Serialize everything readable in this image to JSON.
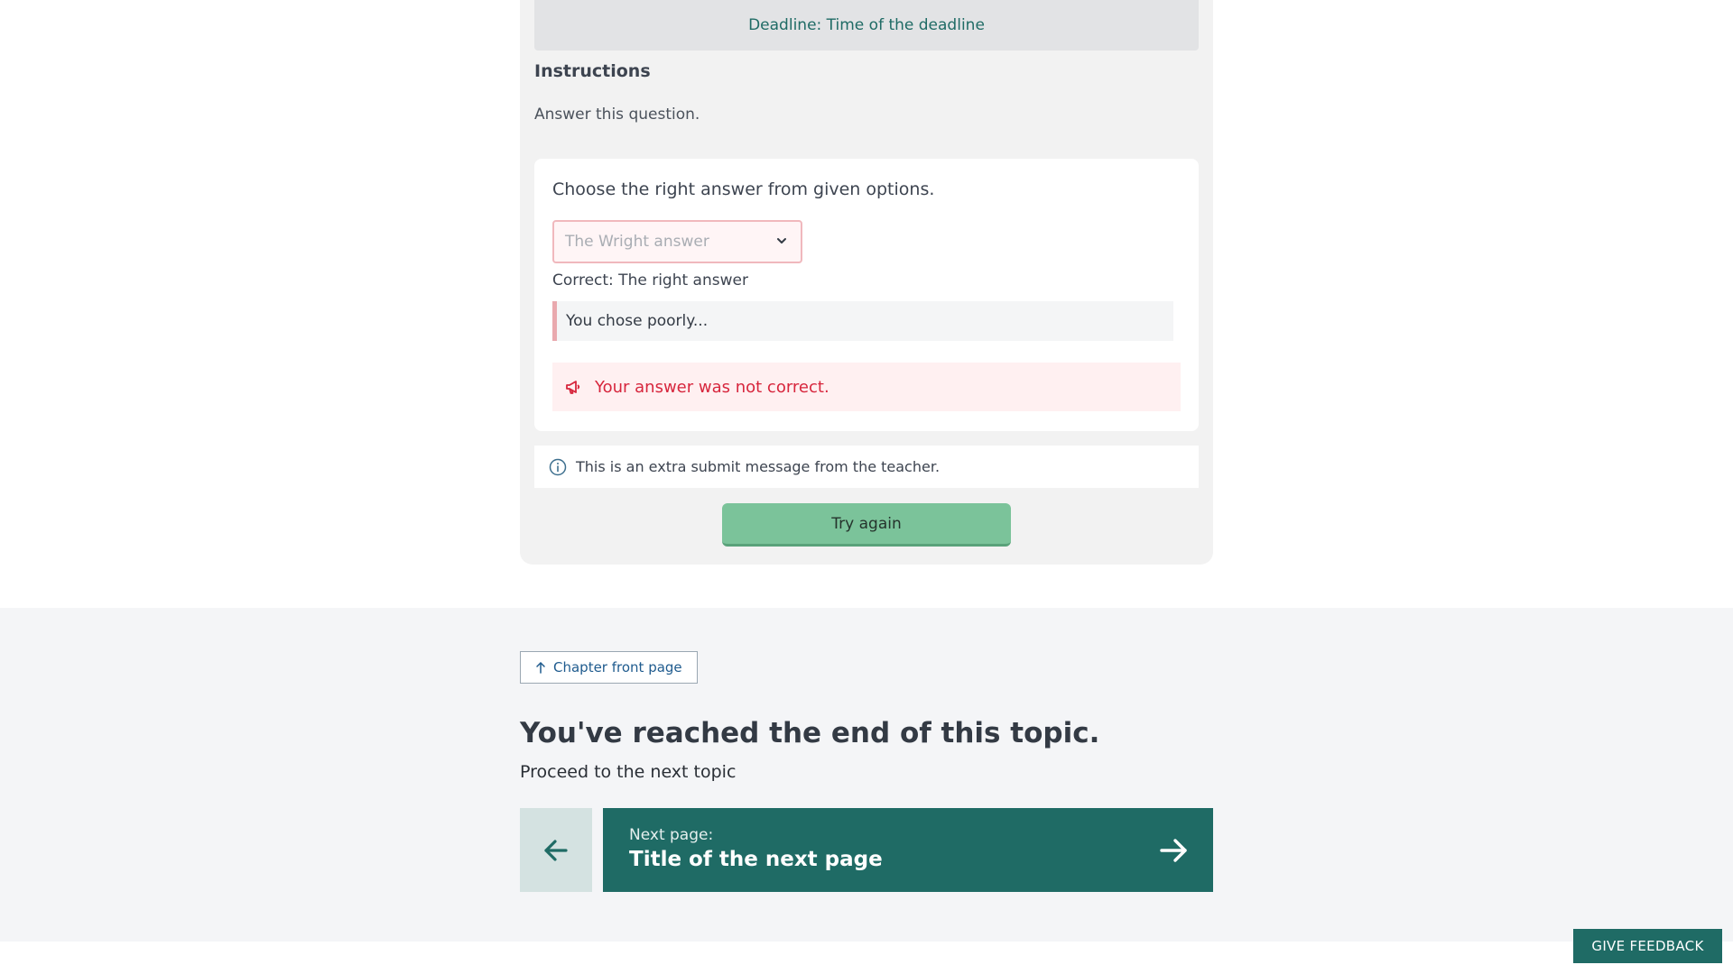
{
  "exercise": {
    "deadline": "Deadline: Time of the deadline",
    "instructions_heading": "Instructions",
    "instructions_text": "Answer this question.",
    "question": {
      "prompt": "Choose the right answer from given options.",
      "selected_value": "The Wright answer",
      "correct_text": "Correct: The right answer",
      "feedback": "You chose poorly...",
      "error_message": "Your answer was not correct."
    },
    "teacher_message": "This is an extra submit message from the teacher.",
    "try_again_label": "Try again"
  },
  "navigation": {
    "chapter_link": "Chapter front page",
    "end_heading": "You've reached the end of this topic.",
    "proceed_text": "Proceed to the next topic",
    "next_label": "Next page:",
    "next_title": "Title of the next page"
  },
  "feedback_button": "GIVE FEEDBACK",
  "icons": {
    "error": "megaphone-icon",
    "info": "info-icon",
    "chapter": "arrow-up-icon",
    "prev": "arrow-left-icon",
    "next": "arrow-right-icon",
    "select": "chevron-down-icon"
  },
  "colors": {
    "brand": "#1f6b65",
    "success": "#7bc39a",
    "error": "#d7263d"
  }
}
